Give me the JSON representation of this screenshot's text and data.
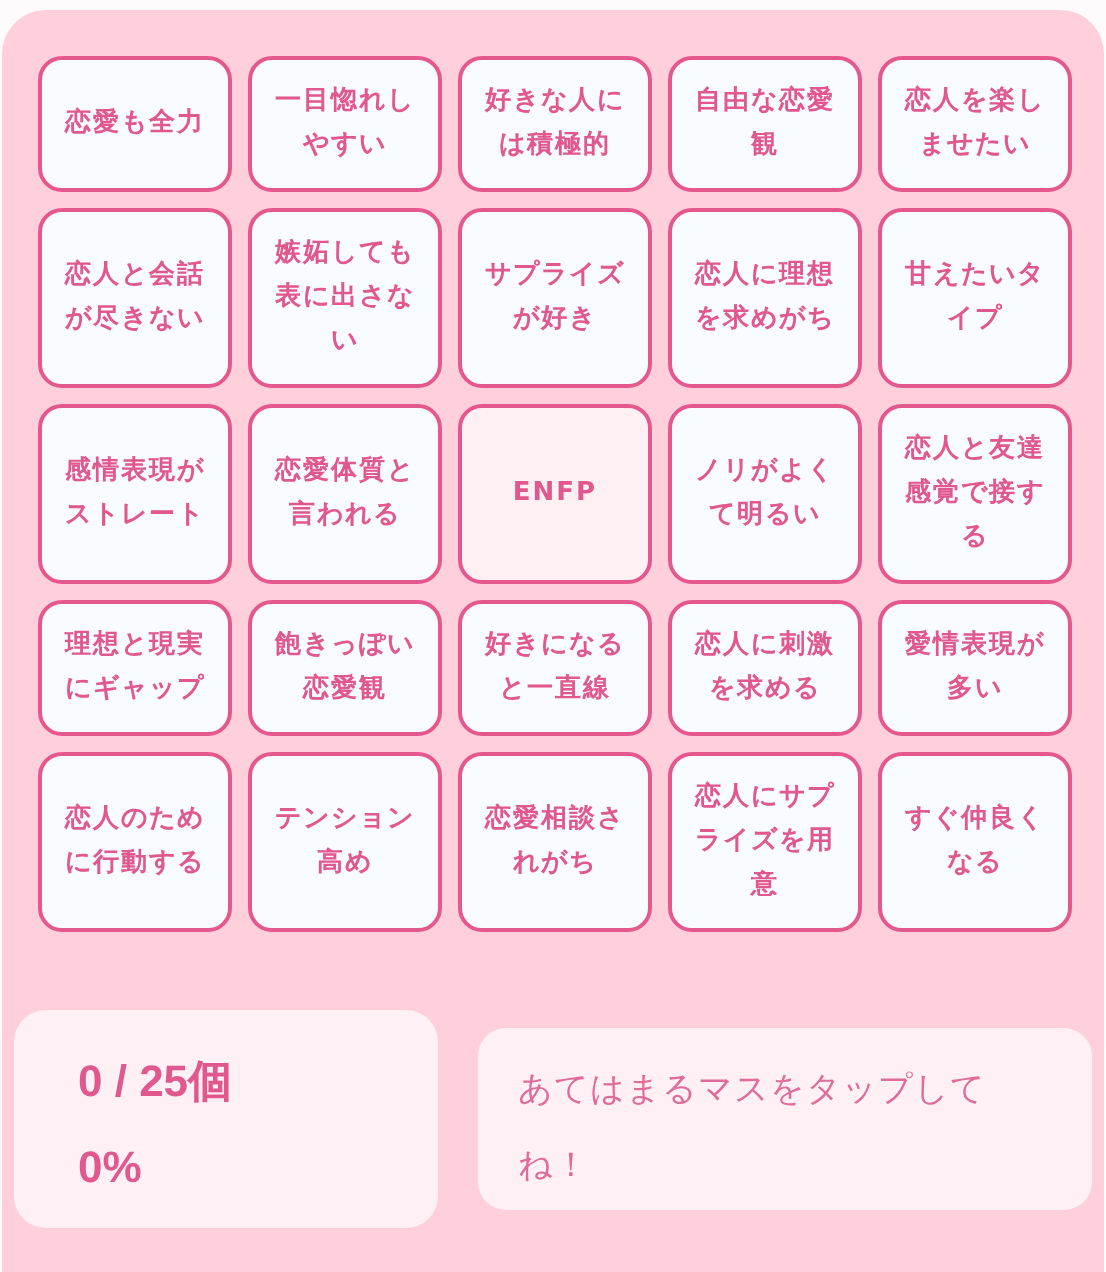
{
  "cells": [
    {
      "label": "恋愛も全力",
      "kind": "normal",
      "selected": false
    },
    {
      "label": "一目惚れしやすい",
      "kind": "normal",
      "selected": false
    },
    {
      "label": "好きな人には積極的",
      "kind": "normal",
      "selected": false
    },
    {
      "label": "自由な恋愛観",
      "kind": "normal",
      "selected": false
    },
    {
      "label": "恋人を楽しませたい",
      "kind": "normal",
      "selected": false
    },
    {
      "label": "恋人と会話が尽きない",
      "kind": "normal",
      "selected": false
    },
    {
      "label": "嫉妬しても表に出さない",
      "kind": "normal",
      "selected": false
    },
    {
      "label": "サプライズが好き",
      "kind": "normal",
      "selected": false
    },
    {
      "label": "恋人に理想を求めがち",
      "kind": "normal",
      "selected": false
    },
    {
      "label": "甘えたいタイプ",
      "kind": "normal",
      "selected": false
    },
    {
      "label": "感情表現がストレート",
      "kind": "normal",
      "selected": false
    },
    {
      "label": "恋愛体質と言われる",
      "kind": "normal",
      "selected": false
    },
    {
      "label": "ENFP",
      "kind": "free",
      "selected": false
    },
    {
      "label": "ノリがよくて明るい",
      "kind": "normal",
      "selected": false
    },
    {
      "label": "恋人と友達感覚で接する",
      "kind": "normal",
      "selected": false
    },
    {
      "label": "理想と現実にギャップ",
      "kind": "normal",
      "selected": false
    },
    {
      "label": "飽きっぽい恋愛観",
      "kind": "normal",
      "selected": false
    },
    {
      "label": "好きになると一直線",
      "kind": "normal",
      "selected": false
    },
    {
      "label": "恋人に刺激を求める",
      "kind": "normal",
      "selected": false
    },
    {
      "label": "愛情表現が多い",
      "kind": "normal",
      "selected": false
    },
    {
      "label": "恋人のために行動する",
      "kind": "normal",
      "selected": false
    },
    {
      "label": "テンション高め",
      "kind": "normal",
      "selected": false
    },
    {
      "label": "恋愛相談されがち",
      "kind": "normal",
      "selected": false
    },
    {
      "label": "恋人にサプライズを用意",
      "kind": "normal",
      "selected": false
    },
    {
      "label": "すぐ仲良くなる",
      "kind": "normal",
      "selected": false
    }
  ],
  "stats": {
    "count": "0 / 25個",
    "percent": "0%"
  },
  "message": "あてはまるマスをタップしてね！"
}
